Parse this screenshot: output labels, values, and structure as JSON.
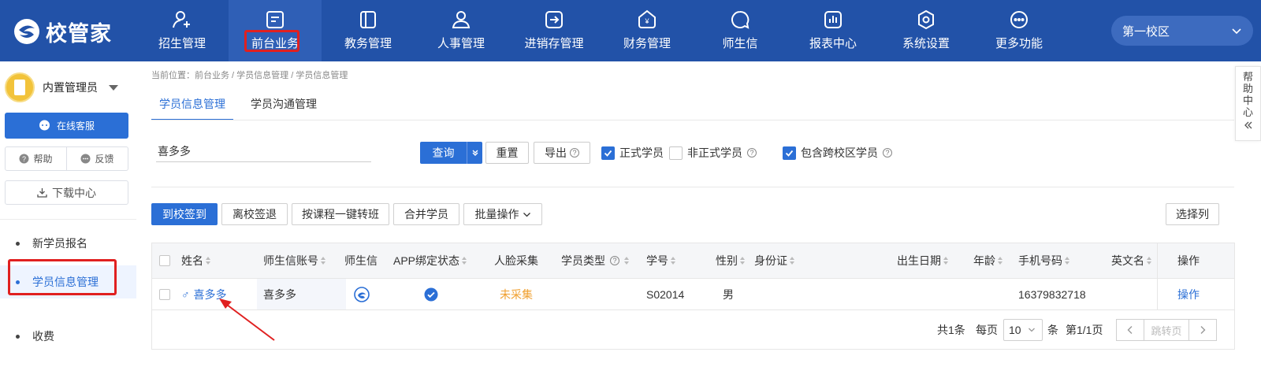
{
  "app": {
    "brand": "校管家"
  },
  "colors": {
    "nav_bg": "#2252a8",
    "accent": "#2b6fd6",
    "warn": "#f0a030",
    "highlight_box": "#e02020"
  },
  "nav": {
    "items": [
      {
        "label": "招生管理",
        "icon": "user-add-icon"
      },
      {
        "label": "前台业务",
        "icon": "reception-icon",
        "active": true
      },
      {
        "label": "教务管理",
        "icon": "book-icon"
      },
      {
        "label": "人事管理",
        "icon": "person-icon"
      },
      {
        "label": "进销存管理",
        "icon": "inventory-icon"
      },
      {
        "label": "财务管理",
        "icon": "finance-icon"
      },
      {
        "label": "师生信",
        "icon": "chat-icon"
      },
      {
        "label": "报表中心",
        "icon": "report-icon"
      },
      {
        "label": "系统设置",
        "icon": "settings-icon"
      },
      {
        "label": "更多功能",
        "icon": "more-icon"
      }
    ],
    "campus": "第一校区"
  },
  "sidebar": {
    "user": "内置管理员",
    "service_btn": "在线客服",
    "help": "帮助",
    "feedback": "反馈",
    "download": "下载中心",
    "menu": [
      {
        "label": "新学员报名"
      },
      {
        "label": "学员信息管理",
        "active": true
      },
      {
        "label": "收费"
      }
    ]
  },
  "main": {
    "breadcrumb": "当前位置：前台业务 / 学员信息管理 / 学员信息管理",
    "tabs": [
      "学员信息管理",
      "学员沟通管理"
    ],
    "search_value": "喜多多",
    "query": "查询",
    "reset": "重置",
    "export": "导出",
    "filters": [
      {
        "label": "正式学员",
        "checked": true
      },
      {
        "label": "非正式学员",
        "checked": false
      },
      {
        "label": "包含跨校区学员",
        "checked": true
      }
    ],
    "actions": [
      "到校签到",
      "离校签退",
      "按课程一键转班",
      "合并学员",
      "批量操作"
    ],
    "select_columns": "选择列"
  },
  "table": {
    "headers": [
      "姓名",
      "师生信账号",
      "师生信",
      "APP绑定状态",
      "人脸采集",
      "学员类型",
      "学号",
      "性别",
      "身份证",
      "出生日期",
      "年龄",
      "手机号码",
      "英文名",
      "操作"
    ],
    "rows": [
      {
        "gender_symbol": "♂",
        "name": "喜多多",
        "account": "喜多多",
        "face": "未采集",
        "student_no": "S02014",
        "gender": "男",
        "phone": "16379832718",
        "op": "操作"
      }
    ]
  },
  "pager": {
    "total": "共1条",
    "per_page": "每页",
    "page_size": "10",
    "unit": "条",
    "page_info": "第1/1页",
    "jump": "跳转页"
  },
  "help_center": "帮助中心"
}
